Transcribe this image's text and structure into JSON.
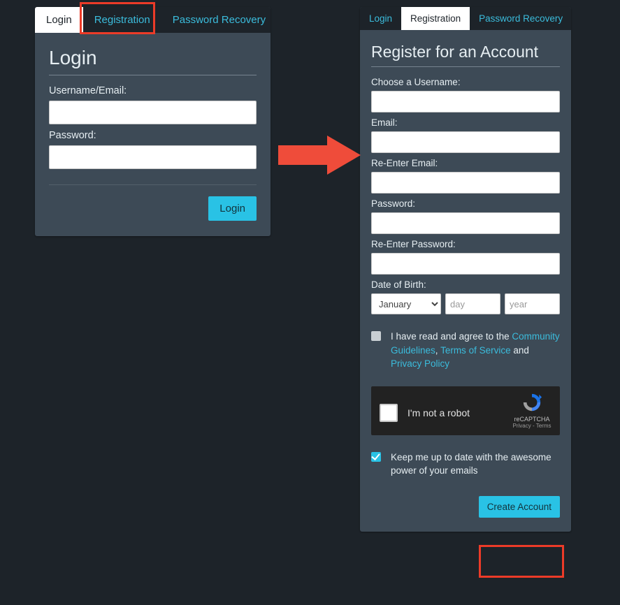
{
  "tabs": {
    "login": "Login",
    "registration": "Registration",
    "recovery": "Password Recovery"
  },
  "loginCard": {
    "title": "Login",
    "usernameLabel": "Username/Email:",
    "passwordLabel": "Password:",
    "button": "Login"
  },
  "registerCard": {
    "title": "Register for an Account",
    "usernameLabel": "Choose a Username:",
    "emailLabel": "Email:",
    "reemailLabel": "Re-Enter Email:",
    "passwordLabel": "Password:",
    "repasswordLabel": "Re-Enter Password:",
    "dobLabel": "Date of Birth:",
    "monthValue": "January",
    "dayPlaceholder": "day",
    "yearPlaceholder": "year",
    "agreePrefix": "I have read and agree to the ",
    "linkGuidelines": "Community Guidelines",
    "comma": ", ",
    "linkTerms": "Terms of Service",
    "and": " and ",
    "linkPrivacy": "Privacy Policy",
    "recaptchaText": "I'm not a robot",
    "recaptchaBrand": "reCAPTCHA",
    "recaptchaSub": "Privacy - Terms",
    "keepUpdated": "Keep me up to date with the awesome power of your emails",
    "button": "Create Account"
  }
}
